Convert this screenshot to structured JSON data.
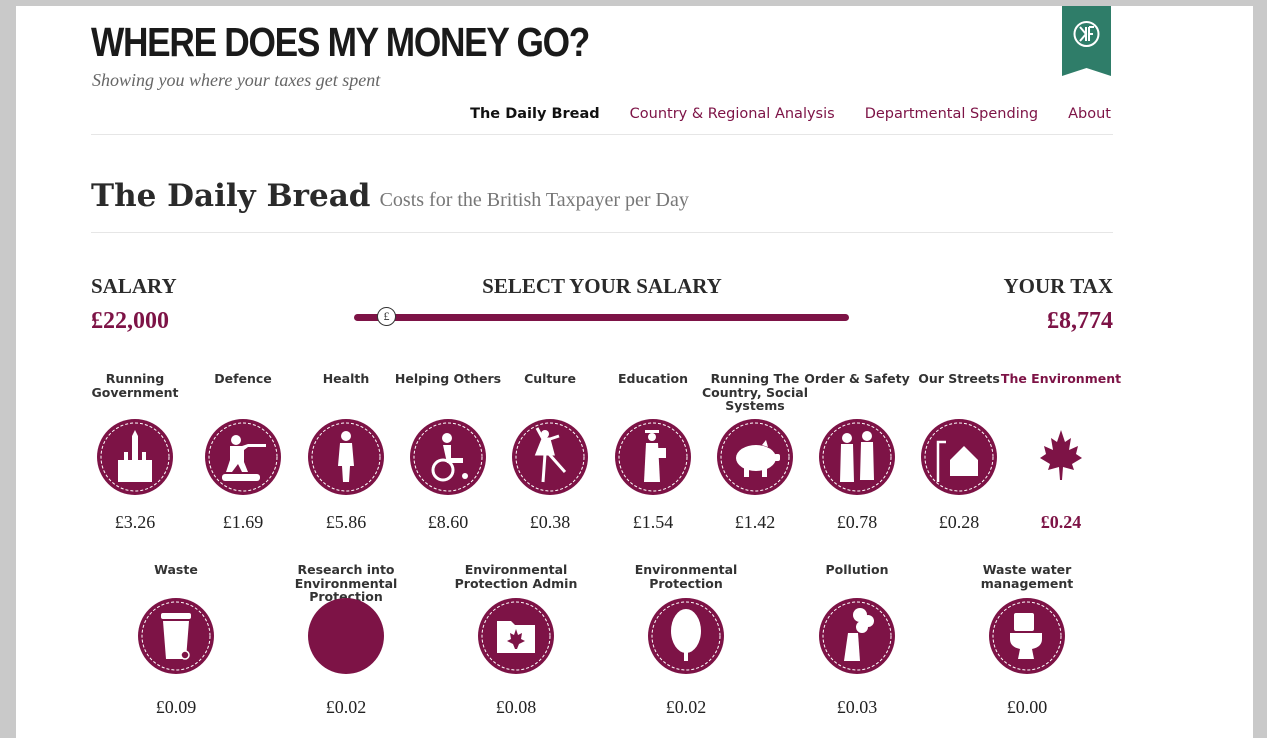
{
  "header": {
    "site_title": "WHERE DOES MY MONEY GO?",
    "tagline": "Showing you where your taxes get spent",
    "badge_icon": "okf-logo-icon"
  },
  "nav": {
    "items": [
      {
        "label": "The Daily Bread",
        "active": true
      },
      {
        "label": "Country & Regional Analysis",
        "active": false
      },
      {
        "label": "Departmental Spending",
        "active": false
      },
      {
        "label": "About",
        "active": false
      }
    ]
  },
  "page": {
    "heading": "The Daily Bread",
    "subheading": "Costs for the British Taxpayer per Day"
  },
  "salary": {
    "label": "SALARY",
    "value": "£22,000",
    "select_label": "SELECT YOUR SALARY",
    "handle_symbol": "£",
    "tax_label": "YOUR TAX",
    "tax_value": "£8,774"
  },
  "colors": {
    "accent": "#7d1346",
    "badge": "#2f7d69"
  },
  "categories": [
    {
      "label": "Running Government",
      "amount": "£3.26",
      "icon": "parliament-icon"
    },
    {
      "label": "Defence",
      "amount": "£1.69",
      "icon": "soldier-icon"
    },
    {
      "label": "Health",
      "amount": "£5.86",
      "icon": "nurse-icon"
    },
    {
      "label": "Helping Others",
      "amount": "£8.60",
      "icon": "wheelchair-icon"
    },
    {
      "label": "Culture",
      "amount": "£0.38",
      "icon": "ballerina-icon"
    },
    {
      "label": "Education",
      "amount": "£1.54",
      "icon": "graduate-icon"
    },
    {
      "label": "Running The Country, Social Systems",
      "amount": "£1.42",
      "icon": "piggy-bank-icon"
    },
    {
      "label": "Order & Safety",
      "amount": "£0.78",
      "icon": "police-icon"
    },
    {
      "label": "Our Streets",
      "amount": "£0.28",
      "icon": "house-lamp-icon"
    },
    {
      "label": "The Environment",
      "amount": "£0.24",
      "icon": "maple-leaf-icon",
      "selected": true
    }
  ],
  "subcategories": [
    {
      "label": "Waste",
      "amount": "£0.09",
      "icon": "wheelie-bin-icon"
    },
    {
      "label": "Research into Environmental Protection",
      "amount": "£0.02",
      "icon": "blank-circle-icon"
    },
    {
      "label": "Environmental Protection Admin",
      "amount": "£0.08",
      "icon": "folder-leaf-icon"
    },
    {
      "label": "Environmental Protection",
      "amount": "£0.02",
      "icon": "tree-icon"
    },
    {
      "label": "Pollution",
      "amount": "£0.03",
      "icon": "chimney-smoke-icon"
    },
    {
      "label": "Waste water management",
      "amount": "£0.00",
      "icon": "toilet-icon"
    }
  ]
}
